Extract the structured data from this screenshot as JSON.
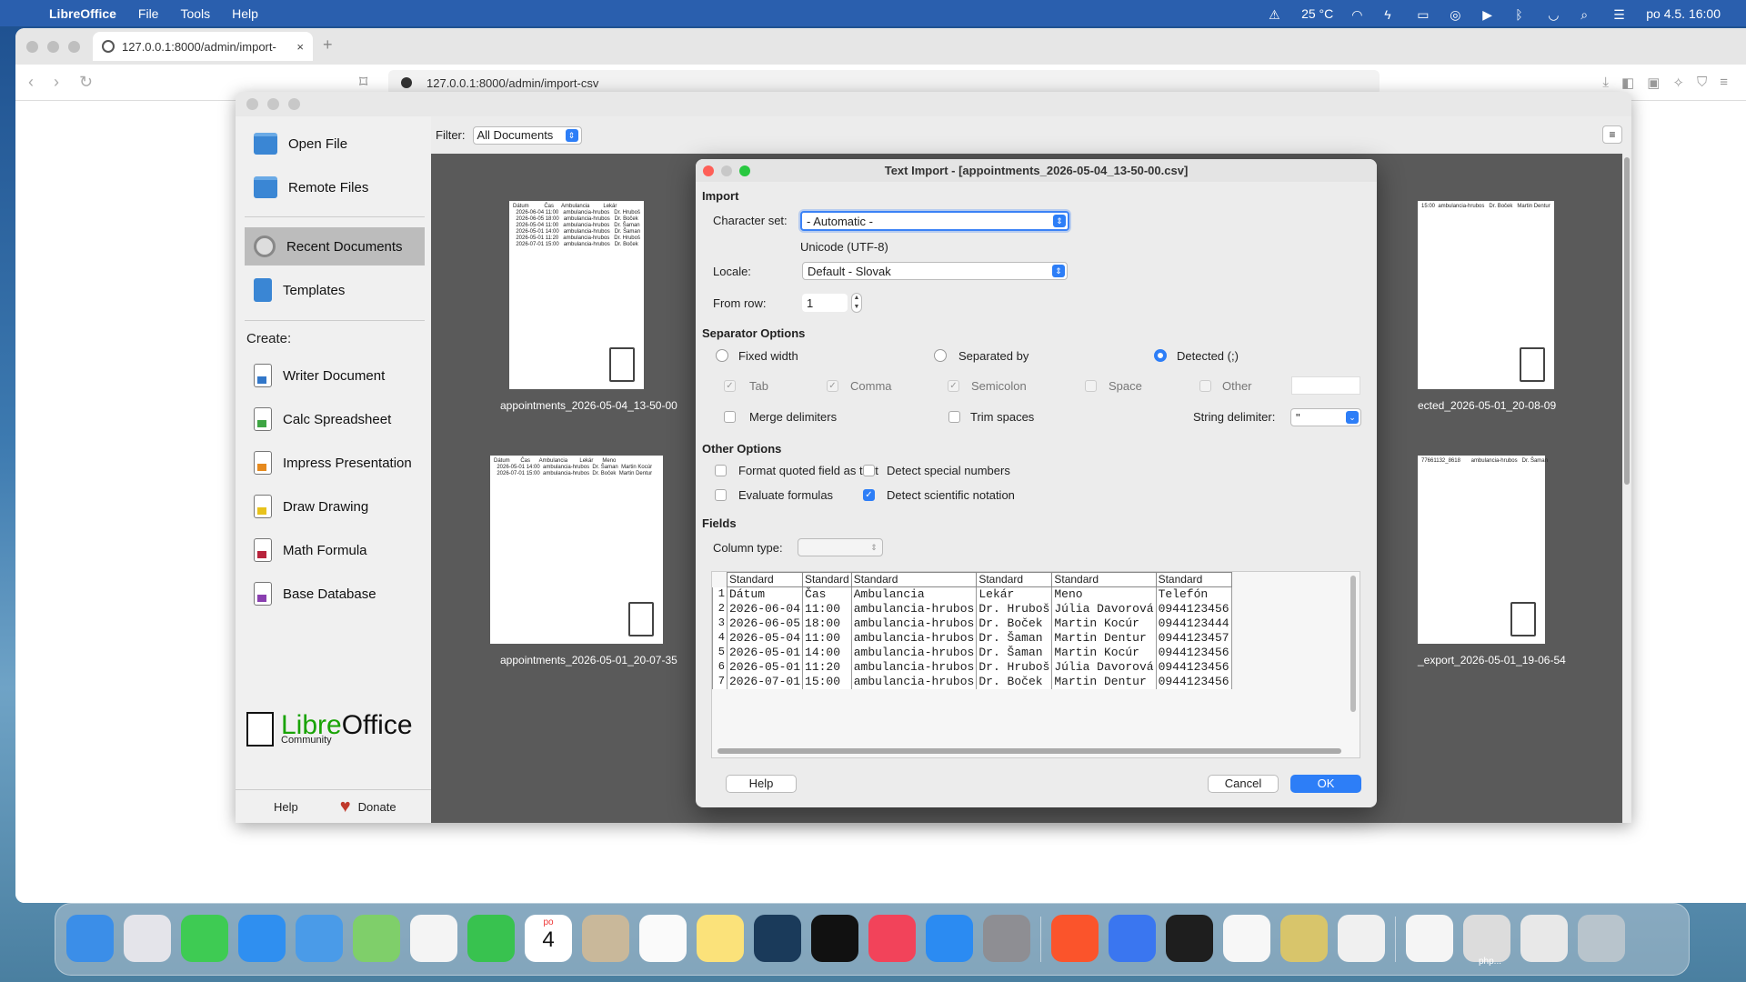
{
  "menubar": {
    "app_name": "LibreOffice",
    "items": [
      "File",
      "Tools",
      "Help"
    ],
    "temperature": "25 °C",
    "datetime": "po 4.5.  16:00"
  },
  "browser": {
    "tab_title": "127.0.0.1:8000/admin/import-",
    "tab_close": "×",
    "new_tab": "+",
    "url": "127.0.0.1:8000/admin/import-csv"
  },
  "start_center": {
    "sidebar": {
      "open_file": "Open File",
      "remote_files": "Remote Files",
      "recent_documents": "Recent Documents",
      "templates": "Templates",
      "create_label": "Create:",
      "writer": "Writer Document",
      "calc": "Calc Spreadsheet",
      "impress": "Impress Presentation",
      "draw": "Draw Drawing",
      "math": "Math Formula",
      "base": "Base Database",
      "logo_left": "Libre",
      "logo_right": "Office",
      "logo_sub": "Community",
      "help": "Help",
      "donate": "Donate"
    },
    "filter_label": "Filter:",
    "filter_value": "All Documents",
    "recent": [
      {
        "name": "appointments_2026-05-04_13-50-00",
        "preview": "Dátum          Čas     Ambulancia         Lekár\n  2026-06-04 11:00   ambulancia-hrubos   Dr. Hruboš\n  2026-06-05 18:00   ambulancia-hrubos   Dr. Boček\n  2026-05-04 11:00   ambulancia-hrubos   Dr. Šaman\n  2026-05-01 14:00   ambulancia-hrubos   Dr. Šaman\n  2026-05-01 11:20   ambulancia-hrubos   Dr. Hruboš\n  2026-07-01 15:00   ambulancia-hrubos   Dr. Boček"
      },
      {
        "name": "ected_2026-05-01_20-08-09",
        "preview": "15:00  ambulancia-hrubos   Dr. Boček   Martin Dentur"
      },
      {
        "name": "appointments_2026-05-01_20-07-35",
        "preview": "Dátum       Čas      Ambulancia        Lekár      Meno\n  2026-05-01 14:00  ambulancia-hrubos  Dr. Šaman  Martin Kocúr\n  2026-07-01 15:00  ambulancia-hrubos  Dr. Boček  Martin Dentur"
      },
      {
        "name": "_export_2026-05-01_19-06-54",
        "preview": "77661132_8618       ambulancia-hrubos   Dr. Šaman"
      }
    ],
    "recent_header_right": "Čas    Ambulancia          Lekár      Meno",
    "recent_header_right2": "Ambulancia      Lekár"
  },
  "dialog": {
    "title": "Text Import - [appointments_2026-05-04_13-50-00.csv]",
    "import_heading": "Import",
    "charset_label": "Character set:",
    "charset_value": "- Automatic -",
    "charset_detected": "Unicode (UTF-8)",
    "locale_label": "Locale:",
    "locale_value": "Default - Slovak",
    "from_row_label": "From row:",
    "from_row_value": "1",
    "separator_heading": "Separator Options",
    "fixed_width": "Fixed width",
    "separated_by": "Separated by",
    "detected": "Detected (;)",
    "tab": "Tab",
    "comma": "Comma",
    "semicolon": "Semicolon",
    "space": "Space",
    "other": "Other",
    "merge_delimiters": "Merge delimiters",
    "trim_spaces": "Trim spaces",
    "string_delimiter_label": "String delimiter:",
    "string_delimiter_value": "\"",
    "other_heading": "Other Options",
    "format_quoted": "Format quoted field as text",
    "detect_special": "Detect special numbers",
    "evaluate_formulas": "Evaluate formulas",
    "detect_scientific": "Detect scientific notation",
    "fields_heading": "Fields",
    "column_type_label": "Column type:",
    "column_headers": [
      "Standard",
      "Standard",
      "Standard",
      "Standard",
      "Standard",
      "Standard"
    ],
    "rows": [
      [
        "1",
        "Dátum",
        "Čas",
        "Ambulancia",
        "Lekár",
        "Meno",
        "Telefón"
      ],
      [
        "2",
        "2026-06-04",
        "11:00",
        "ambulancia-hrubos",
        "Dr. Hruboš",
        "Júlia Davorová",
        "0944123456"
      ],
      [
        "3",
        "2026-06-05",
        "18:00",
        "ambulancia-hrubos",
        "Dr. Boček",
        "Martin Kocúr",
        "0944123444"
      ],
      [
        "4",
        "2026-05-04",
        "11:00",
        "ambulancia-hrubos",
        "Dr. Šaman",
        "Martin Dentur",
        "0944123457"
      ],
      [
        "5",
        "2026-05-01",
        "14:00",
        "ambulancia-hrubos",
        "Dr. Šaman",
        "Martin Kocúr",
        "0944123456"
      ],
      [
        "6",
        "2026-05-01",
        "11:20",
        "ambulancia-hrubos",
        "Dr. Hruboš",
        "Júlia Davorová",
        "0944123456"
      ],
      [
        "7",
        "2026-07-01",
        "15:00",
        "ambulancia-hrubos",
        "Dr. Boček",
        "Martin Dentur",
        "0944123456"
      ]
    ],
    "help_button": "Help",
    "cancel_button": "Cancel",
    "ok_button": "OK"
  },
  "dock": {
    "calendar_month": "po",
    "calendar_day": "4",
    "php_label": "php..."
  }
}
